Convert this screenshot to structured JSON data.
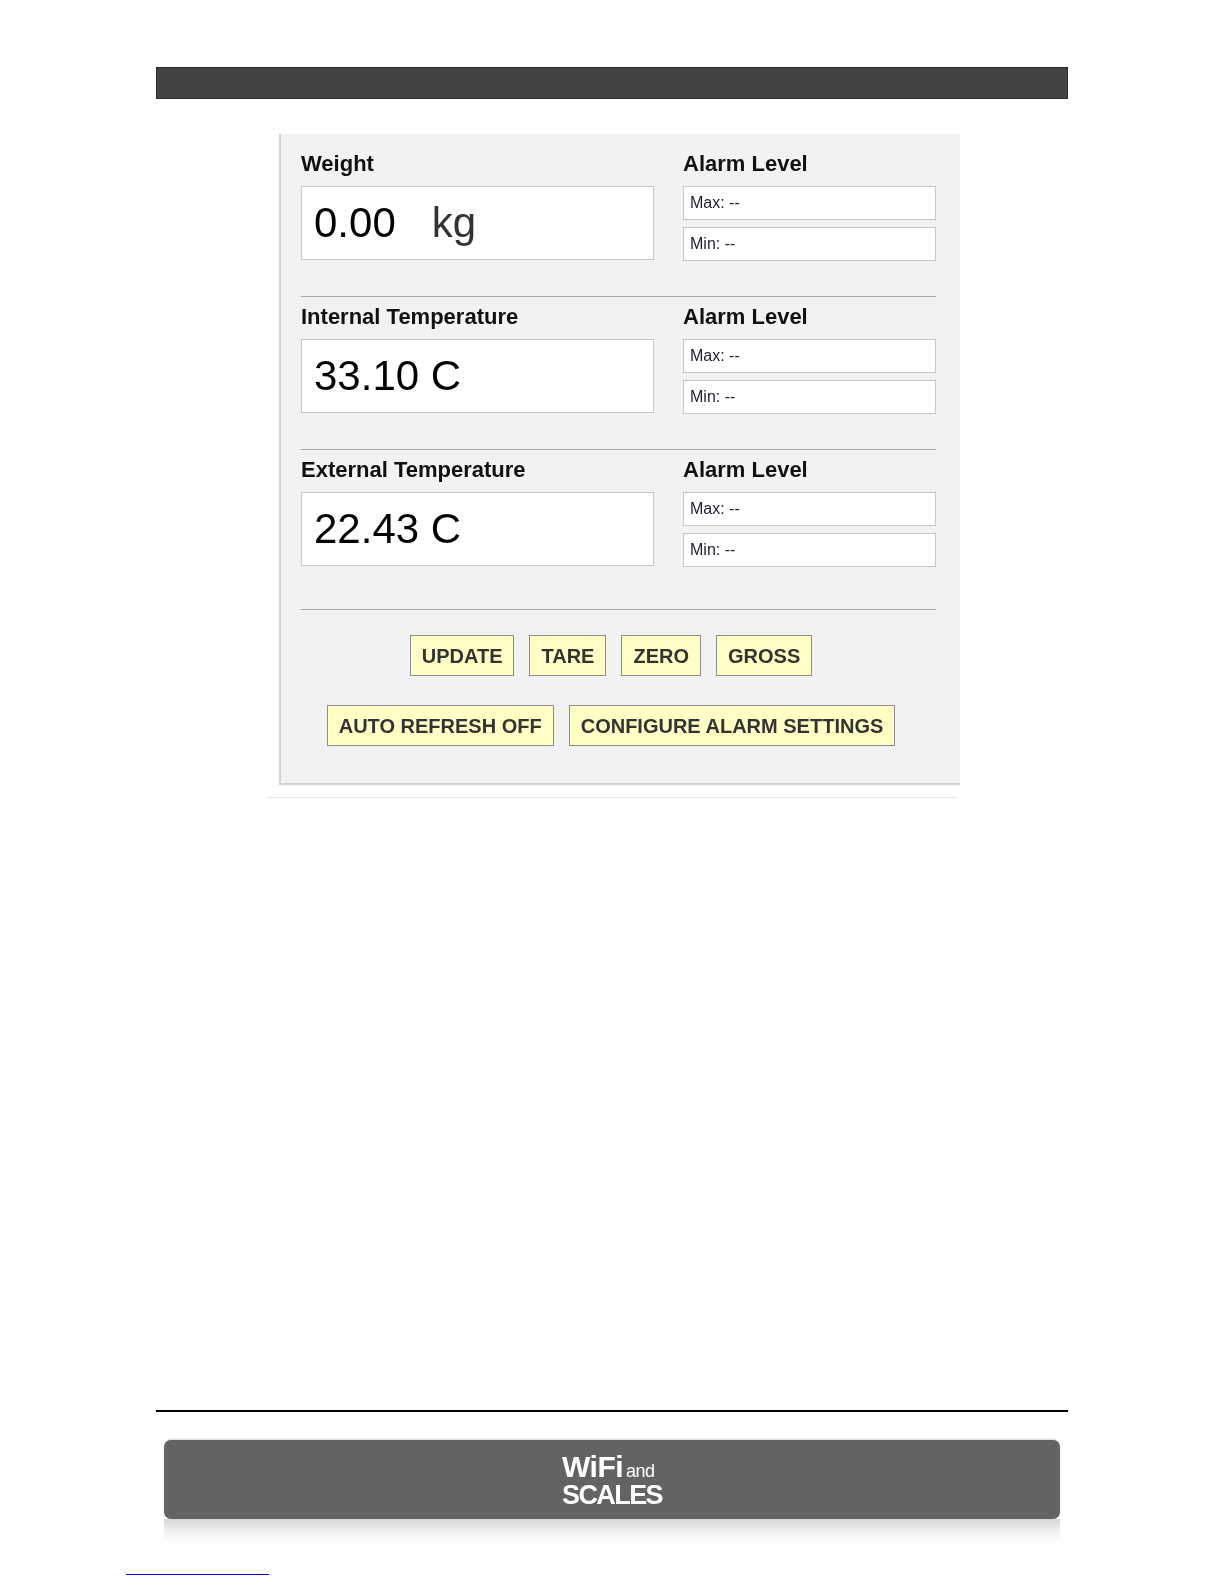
{
  "readings": [
    {
      "label": "Weight",
      "value": "0.00",
      "unit": "kg",
      "alarm": {
        "title": "Alarm Level",
        "max": "Max: --",
        "min": "Min: --"
      }
    },
    {
      "label": "Internal Temperature",
      "value": "33.10 C",
      "alarm": {
        "title": "Alarm Level",
        "max": "Max: --",
        "min": "Min: --"
      }
    },
    {
      "label": "External Temperature",
      "value": "22.43 C",
      "alarm": {
        "title": "Alarm Level",
        "max": "Max: --",
        "min": "Min: --"
      }
    }
  ],
  "button_rows": [
    {
      "buttons": [
        "UPDATE",
        "TARE",
        "ZERO",
        "GROSS"
      ]
    },
    {
      "buttons": [
        "AUTO REFRESH OFF",
        "CONFIGURE ALARM SETTINGS"
      ]
    }
  ],
  "footer": {
    "logo": {
      "word_1": "WiFi",
      "word_2": "and",
      "word_3": "SCALES"
    }
  }
}
